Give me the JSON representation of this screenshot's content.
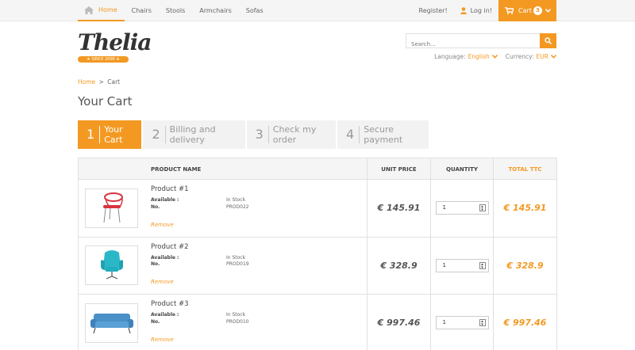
{
  "nav": {
    "items": [
      {
        "label": "Home",
        "active": true
      },
      {
        "label": "Chairs"
      },
      {
        "label": "Stools"
      },
      {
        "label": "Armchairs"
      },
      {
        "label": "Sofas"
      }
    ],
    "register": "Register!",
    "login": "Log in!",
    "cart_label": "Cart",
    "cart_count": "3"
  },
  "header": {
    "logo_text": "Thelia",
    "logo_tagline": "★ SINCE 2006 ★",
    "search_placeholder": "Search...",
    "language_label": "Language:",
    "language_value": "English",
    "currency_label": "Currency:",
    "currency_value": "EUR"
  },
  "breadcrumb": {
    "home": "Home",
    "separator": ">",
    "current": "Cart"
  },
  "page_title": "Your Cart",
  "steps": [
    {
      "num": "1",
      "label": "Your Cart",
      "active": true
    },
    {
      "num": "2",
      "label": "Billing and delivery"
    },
    {
      "num": "3",
      "label": "Check my order"
    },
    {
      "num": "4",
      "label": "Secure payment"
    }
  ],
  "table": {
    "headers": {
      "name": "PRODUCT NAME",
      "price": "UNIT PRICE",
      "qty": "QUANTITY",
      "total": "TOTAL TTC"
    },
    "available_label": "Available :",
    "no_label": "No.",
    "remove_label": "Remove",
    "rows": [
      {
        "name": "Product #1",
        "availability": "In Stock",
        "ref": "PROD022",
        "price": "€ 145.91",
        "qty": "1",
        "total": "€ 145.91",
        "thumb": "red-chair"
      },
      {
        "name": "Product #2",
        "availability": "In Stock",
        "ref": "PROD019",
        "price": "€ 328.9",
        "qty": "1",
        "total": "€ 328.9",
        "thumb": "teal-armchair"
      },
      {
        "name": "Product #3",
        "availability": "In Stock",
        "ref": "PROD010",
        "price": "€ 997.46",
        "qty": "1",
        "total": "€ 997.46",
        "thumb": "blue-sofa"
      }
    ]
  },
  "colors": {
    "accent": "#f39922"
  }
}
